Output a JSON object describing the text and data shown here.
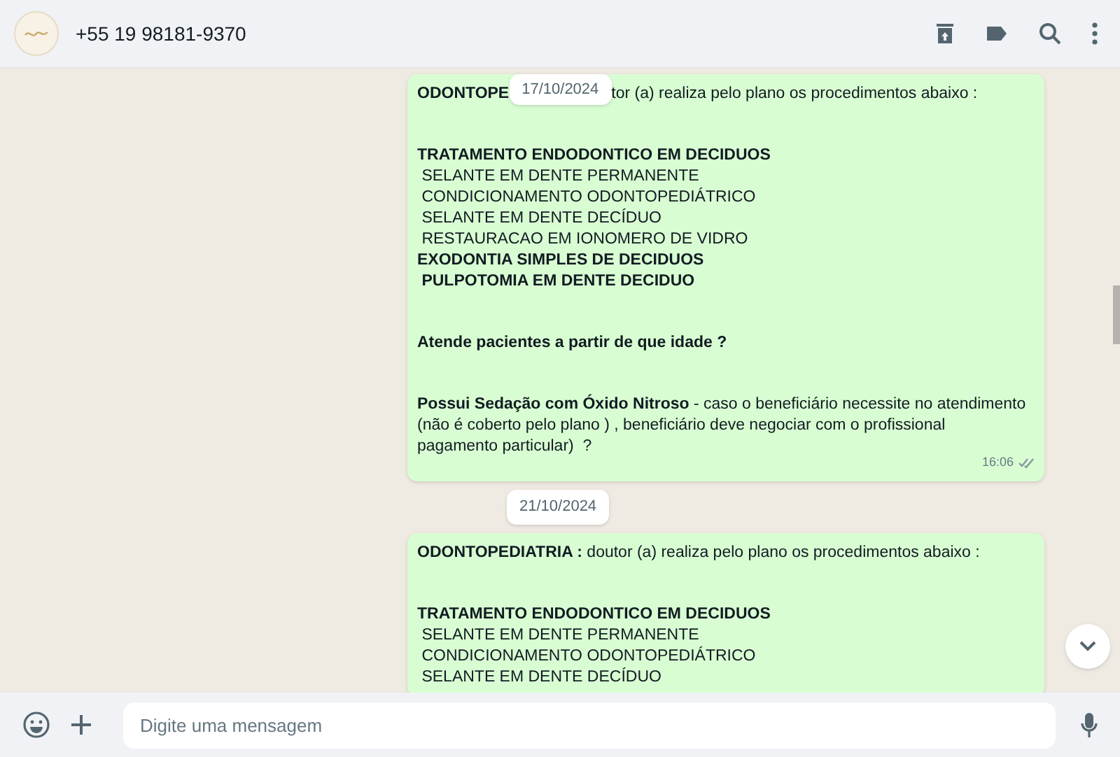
{
  "header": {
    "contact": "+55 19 98181-9370"
  },
  "messages": [
    {
      "sticky_date": "17/10/2024",
      "first_line": {
        "lead": "ODONTOPE",
        "rest": "tor (a) realiza pelo plano os procedimentos abaixo :"
      },
      "paragraphs": [
        [
          {
            "text": "TRATAMENTO ENDODONTICO EM DECIDUOS",
            "bold": true
          },
          {
            "text": " SELANTE EM DENTE PERMANENTE",
            "bold": false
          },
          {
            "text": " CONDICIONAMENTO ODONTOPEDIÁTRICO",
            "bold": false
          },
          {
            "text": " SELANTE EM DENTE DECÍDUO",
            "bold": false
          },
          {
            "text": " RESTAURACAO EM IONOMERO DE VIDRO",
            "bold": false
          },
          {
            "text": "EXODONTIA SIMPLES DE DECIDUOS",
            "bold": true
          },
          {
            "text": " PULPOTOMIA EM DENTE DECIDUO",
            "bold": true
          }
        ],
        [
          {
            "text": "Atende pacientes a partir de que idade ?",
            "bold": true
          }
        ],
        [
          {
            "text": "**Possui Sedação com Óxido Nitroso** - caso o beneficiário necessite no atendimento (não é coberto pelo plano ) , beneficiário deve negociar com o profissional pagamento particular)  ?",
            "bold": false
          }
        ]
      ],
      "time": "16:06",
      "read": false
    },
    {
      "date": "21/10/2024",
      "first_line": {
        "lead": "ODONTOPEDIATRIA :",
        "rest": " doutor (a) realiza pelo plano os procedimentos abaixo :"
      },
      "paragraphs": [
        [
          {
            "text": "TRATAMENTO ENDODONTICO EM DECIDUOS",
            "bold": true
          },
          {
            "text": " SELANTE EM DENTE PERMANENTE",
            "bold": false
          },
          {
            "text": " CONDICIONAMENTO ODONTOPEDIÁTRICO",
            "bold": false
          },
          {
            "text": " SELANTE EM DENTE DECÍDUO",
            "bold": false
          }
        ]
      ]
    }
  ],
  "composer": {
    "placeholder": "Digite uma mensagem"
  }
}
